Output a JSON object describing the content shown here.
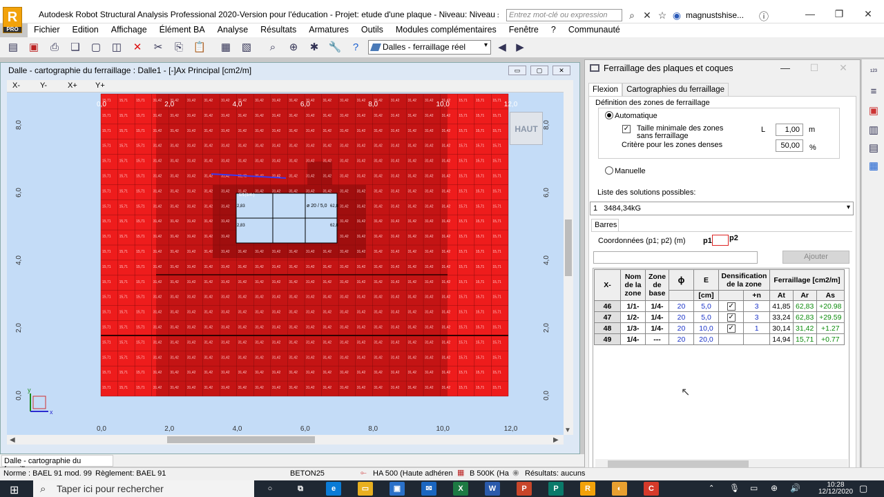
{
  "window": {
    "title": "Autodesk Robot Structural Analysis Professional 2020-Version pour l'éducation - Projet: etude d'une plaque - Niveau: Niveau ±0,00 - ...",
    "search_placeholder": "Entrez mot-clé ou expression",
    "username": "magnustshise...",
    "logo_letter": "R",
    "logo_sub": "PRO"
  },
  "menu": [
    "Fichier",
    "Edition",
    "Affichage",
    "Élément BA",
    "Analyse",
    "Résultats",
    "Armatures",
    "Outils",
    "Modules complémentaires",
    "Fenêtre",
    "?",
    "Communauté"
  ],
  "toolbar": {
    "view_select": "Dalles - ferraillage réel"
  },
  "left_window": {
    "title": "Dalle - cartographie du ferraillage : Dalle1 - [-]Ax Principal [cm2/m]",
    "axis_tabs": [
      "X-",
      "Y-",
      "X+",
      "Y+"
    ],
    "view_cube": "HAUT",
    "x_ticks": [
      "0,0",
      "2,0",
      "4,0",
      "6,0",
      "8,0",
      "10,0",
      "12,0"
    ],
    "y_ticks": [
      "8,0",
      "6,0",
      "4,0",
      "2,0",
      "0,0"
    ],
    "axis_x": "x",
    "axis_y": "y",
    "cell_values": {
      "edge": "15,71",
      "mid": "31,42",
      "dense": "62,83"
    },
    "labels": {
      "zone_a": "1/1(1/4-)",
      "zone_b": "ø 20 / 5,0",
      "v1": "2,83",
      "v2": "2,83",
      "v3": "62,8",
      "v4": "62,8"
    }
  },
  "right_panel": {
    "title": "Ferraillage des plaques et coques",
    "tabs": [
      "Flexion",
      "Cartographies du ferraillage"
    ],
    "section_def": "Définition des zones de ferraillage",
    "auto_label": "Automatique",
    "min_size_label": "Taille minimale des zones sans ferraillage",
    "L_label": "L",
    "min_size_value": "1,00",
    "min_size_unit": "m",
    "dense_label": "Critère pour les zones denses",
    "dense_value": "50,00",
    "dense_unit": "%",
    "manual_label": "Manuelle",
    "solutions_label": "Liste des solutions possibles:",
    "solution_selected_index": "1",
    "solution_selected_value": "3484,34kG",
    "bars_tab": "Barres",
    "coord_label": "Coordonnées (p1; p2) (m)",
    "p1": "p1",
    "p2": "p2",
    "add_button": "Ajouter",
    "table": {
      "h_xminus": "X-",
      "h_name": "Nom de la zone",
      "h_base": "Zone de base",
      "h_phi": "ϕ",
      "h_e": "E",
      "h_dens": "Densification de la zone",
      "h_ferr": "Ferraillage [cm2/m]",
      "h_cm": "[cm]",
      "h_plus_n": "+n",
      "h_at": "At",
      "h_ar": "Ar",
      "h_as": "As",
      "rows": [
        {
          "id": "46",
          "name": "1/1-",
          "base": "1/4-",
          "phi": "20",
          "e": "5,0",
          "dens": true,
          "n": "3",
          "at": "41,85",
          "ar": "62,83",
          "as": "+20.98"
        },
        {
          "id": "47",
          "name": "1/2-",
          "base": "1/4-",
          "phi": "20",
          "e": "5,0",
          "dens": true,
          "n": "3",
          "at": "33,24",
          "ar": "62,83",
          "as": "+29.59"
        },
        {
          "id": "48",
          "name": "1/3-",
          "base": "1/4-",
          "phi": "20",
          "e": "10,0",
          "dens": true,
          "n": "1",
          "at": "30,14",
          "ar": "31,42",
          "as": "+1.27"
        },
        {
          "id": "49",
          "name": "1/4-",
          "base": "---",
          "phi": "20",
          "e": "20,0",
          "dens": false,
          "n": "",
          "at": "14,94",
          "ar": "15,71",
          "as": "+0.77"
        }
      ]
    }
  },
  "status": {
    "window_tab": "Dalle - cartographie du ferraillage",
    "norme": "Norme : BAEL 91 mod. 99",
    "reglement": "Règlement: BAEL 91",
    "beton": "BETON25",
    "acier": "HA 500 (Haute adhéren",
    "treillis": "B 500K (Ha",
    "resultats": "Résultats: aucuns"
  },
  "taskbar": {
    "search": "Taper ici pour rechercher",
    "time": "10:28",
    "date": "12/12/2020"
  }
}
